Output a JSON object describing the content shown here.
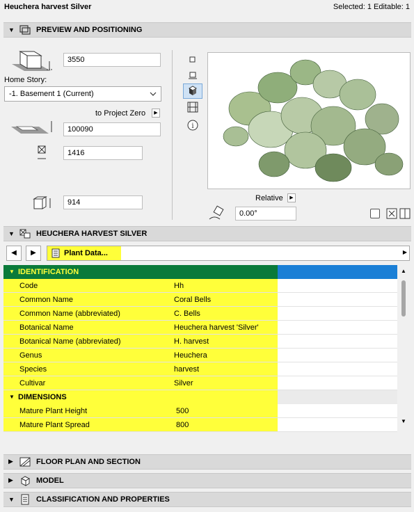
{
  "header": {
    "title": "Heuchera harvest Silver",
    "selection": "Selected: 1 Editable: 1"
  },
  "preview_section": {
    "label": "PREVIEW AND POSITIONING",
    "height_value": "3550",
    "home_story_label": "Home Story:",
    "home_story_value": "-1. Basement 1 (Current)",
    "to_project_zero_label": "to Project Zero",
    "elevation_value": "100090",
    "width_value": "1416",
    "depth_value": "914",
    "relative_label": "Relative",
    "angle_value": "0.00°"
  },
  "object_section": {
    "label": "HEUCHERA HARVEST SILVER",
    "page_label": "Plant Data..."
  },
  "grid": {
    "groups": [
      {
        "label": "IDENTIFICATION",
        "rows": [
          {
            "key": "Code",
            "value": "Hh"
          },
          {
            "key": "Common Name",
            "value": "Coral Bells"
          },
          {
            "key": "Common Name (abbreviated)",
            "value": "C. Bells"
          },
          {
            "key": "Botanical Name",
            "value": "Heuchera harvest 'Silver'"
          },
          {
            "key": "Botanical Name (abbreviated)",
            "value": "H. harvest"
          },
          {
            "key": "Genus",
            "value": "Heuchera"
          },
          {
            "key": "Species",
            "value": "harvest"
          },
          {
            "key": "Cultivar",
            "value": "Silver"
          }
        ]
      },
      {
        "label": "DIMENSIONS",
        "rows": [
          {
            "key": "Mature Plant Height",
            "value": "500"
          },
          {
            "key": "Mature Plant Spread",
            "value": "800"
          }
        ]
      }
    ]
  },
  "collapsed_sections": [
    {
      "label": "FLOOR PLAN AND SECTION"
    },
    {
      "label": "MODEL"
    },
    {
      "label": "CLASSIFICATION AND PROPERTIES"
    }
  ],
  "colors": {
    "identification_bar": "#0a7a3a",
    "selection_blue": "#1a7fd6",
    "highlight": "#ffff3a"
  }
}
